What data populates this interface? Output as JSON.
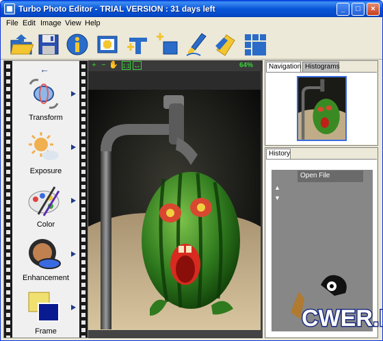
{
  "window": {
    "title": "Turbo Photo Editor  - TRIAL VERSION : 31 days left"
  },
  "title_buttons": {
    "minimize": "_",
    "maximize": "□",
    "close": "×"
  },
  "menu": [
    "File",
    "Edit",
    "Image",
    "View",
    "Help"
  ],
  "toolbar": {
    "icons": [
      "open-icon",
      "save-icon",
      "info-icon",
      "capture-icon",
      "text-icon",
      "add-layer-icon",
      "brush-icon",
      "effects-icon",
      "tiles-icon"
    ]
  },
  "left_panel": {
    "back_icon": "←",
    "categories": [
      {
        "label": "Transform",
        "icon": "transform-icon"
      },
      {
        "label": "Exposure",
        "icon": "exposure-icon"
      },
      {
        "label": "Color",
        "icon": "color-palette-icon"
      },
      {
        "label": "Enhancement",
        "icon": "enhancement-icon"
      },
      {
        "label": "Frame",
        "icon": "frame-icon"
      }
    ]
  },
  "zoom_bar": {
    "zoom_in": "+",
    "zoom_out": "−",
    "pan": "✋",
    "actual_size": "1:1",
    "fit": "↔",
    "zoom_level": "64%"
  },
  "navigation": {
    "tabs": [
      "Navigation",
      "Histograms"
    ],
    "active_tab": "Navigation"
  },
  "history": {
    "tab": "History",
    "up_icon": "▲",
    "down_icon": "▼",
    "items": [
      "Open File"
    ]
  },
  "watermark": {
    "text": "CWER.RU"
  },
  "colors": {
    "title_blue": "#0756d8",
    "zoom_green": "#39d339",
    "image_bg": "#2b2b2b",
    "accent": "#1f3a8a"
  }
}
